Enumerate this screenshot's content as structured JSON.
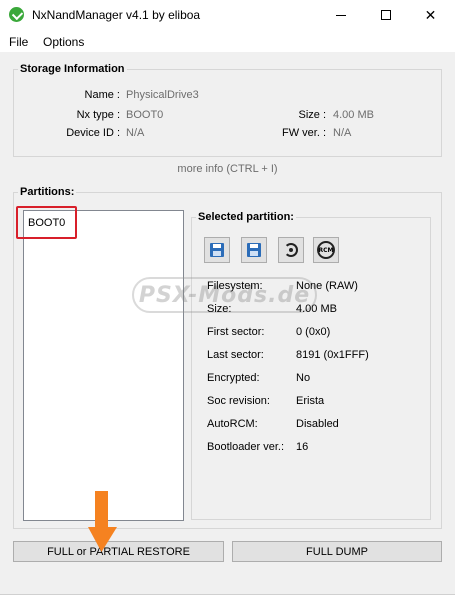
{
  "window": {
    "title": "NxNandManager v4.1 by eliboa",
    "accent_icon_color": "#3aa83a"
  },
  "menu": [
    "File",
    "Options"
  ],
  "storage": {
    "title": "Storage Information",
    "name_label": "Name :",
    "name_value": "PhysicalDrive3",
    "nxtype_label": "Nx type :",
    "nxtype_value": "BOOT0",
    "deviceid_label": "Device ID :",
    "deviceid_value": "N/A",
    "size_label": "Size :",
    "size_value": "4.00 MB",
    "fw_label": "FW ver. :",
    "fw_value": "N/A",
    "more_info": "more info (CTRL + I)"
  },
  "partitions": {
    "title": "Partitions:",
    "items": [
      "BOOT0"
    ],
    "highlight_color": "#d81f2a"
  },
  "selected": {
    "title": "Selected partition:",
    "icons": [
      "dump-floppy-icon",
      "dump-options-floppy-icon",
      "restore-icon",
      "rcm-icon"
    ],
    "rows": [
      {
        "label": "Filesystem:",
        "value": "None (RAW)"
      },
      {
        "label": "Size:",
        "value": "4.00 MB"
      },
      {
        "label": "First sector:",
        "value": "0 (0x0)"
      },
      {
        "label": "Last sector:",
        "value": "8191 (0x1FFF)"
      },
      {
        "label": "Encrypted:",
        "value": "No"
      },
      {
        "label": "Soc revision:",
        "value": "Erista"
      },
      {
        "label": "AutoRCM:",
        "value": "Disabled"
      },
      {
        "label": "Bootloader ver.:",
        "value": "16"
      }
    ]
  },
  "buttons": {
    "restore": "FULL or PARTIAL RESTORE",
    "dump": "FULL DUMP"
  },
  "watermark": "PSX-Mods.de",
  "arrow_color": "#f58220"
}
